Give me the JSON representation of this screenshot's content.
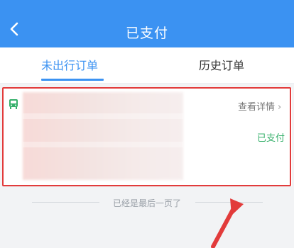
{
  "header": {
    "title": "已支付",
    "back_icon": "chevron-left-icon"
  },
  "tabs": [
    {
      "label": "未出行订单",
      "active": true
    },
    {
      "label": "历史订单",
      "active": false
    }
  ],
  "order_card": {
    "type_icon": "bus-icon",
    "details_label": "查看详情",
    "details_chevron": "›",
    "status": "已支付"
  },
  "list_end_text": "已经是最后一页了",
  "colors": {
    "brand_blue": "#3b92f2",
    "status_green": "#36b06b",
    "highlight_red": "#e23b3b"
  }
}
